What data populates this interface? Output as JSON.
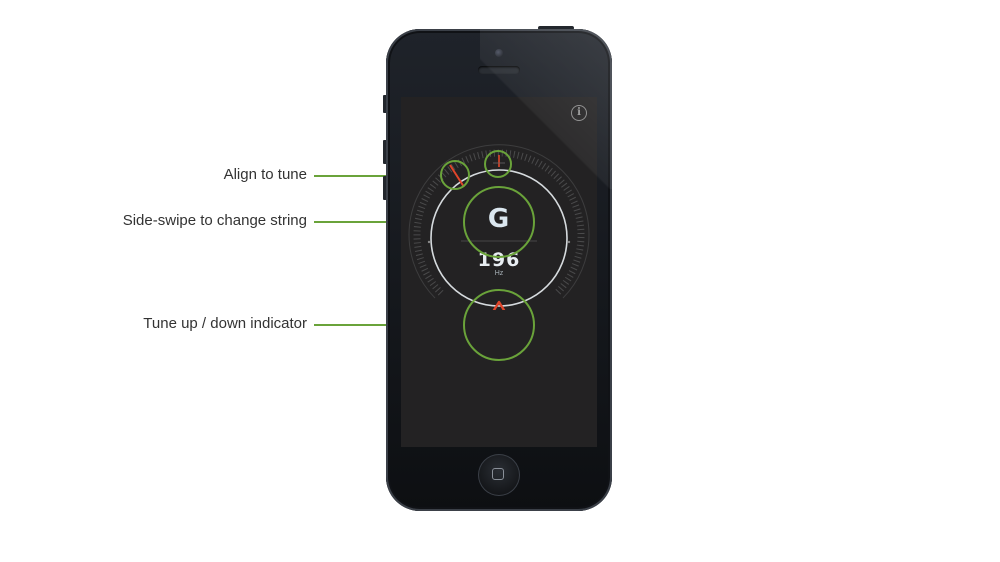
{
  "callouts": {
    "align": "Align to tune",
    "swipe": "Side-swipe to change string",
    "indicator": "Tune up / down indicator"
  },
  "tuner": {
    "note": "G",
    "frequency": "196",
    "unit": "Hz",
    "direction": "up"
  },
  "icons": {
    "info": "info-icon",
    "tune_indicator": "triangle-up-icon",
    "home": "home-button-icon"
  },
  "colors": {
    "callout_green": "#6aa33a",
    "indicator_red": "#e0452a",
    "screen_bg": "#232223",
    "note_text": "#dbe7ef"
  }
}
